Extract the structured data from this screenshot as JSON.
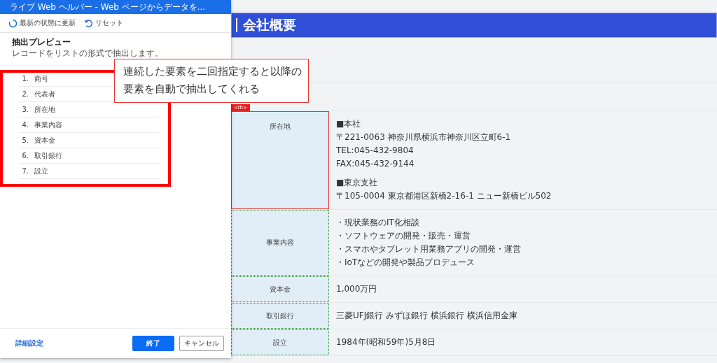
{
  "page": {
    "heading": "会社概要",
    "rows": [
      {
        "label": "所在地",
        "highlighted": true,
        "tag": "<th>",
        "lines": [
          "■本社",
          "〒221-0063 神奈川県横浜市神奈川区立町6-1",
          "TEL:045-432-9804",
          "FAX:045-432-9144",
          "■東京支社",
          "〒105-0004 東京都港区新橋2-16-1 ニュー新橋ビル502"
        ]
      },
      {
        "label": "事業内容",
        "highlighted": false,
        "lines": [
          "・現状業務のIT化相談",
          "・ソフトウェアの開発・販売・運営",
          "・スマホやタブレット用業務アプリの開発・運営",
          "・IoTなどの開発や製品プロデュース"
        ]
      },
      {
        "label": "資本金",
        "highlighted": false,
        "lines": [
          "1,000万円"
        ]
      },
      {
        "label": "取引銀行",
        "highlighted": false,
        "lines": [
          "三菱UFJ銀行 みずほ銀行 横浜銀行 横浜信用金庫"
        ]
      },
      {
        "label": "設立",
        "highlighted": false,
        "lines": [
          "1984年(昭和59年)5月8日"
        ]
      }
    ]
  },
  "window": {
    "title": "ライブ Web ヘルパー - Web ページからデータを...",
    "toolbar": [
      "最新の状態に更新",
      "リセット"
    ],
    "preview_title": "抽出プレビュー",
    "preview_subtitle": "レコードをリストの形式で抽出します。",
    "items": [
      {
        "number": "1.",
        "label": "商号"
      },
      {
        "number": "2.",
        "label": "代表者"
      },
      {
        "number": "3.",
        "label": "所在地"
      },
      {
        "number": "4.",
        "label": "事業内容"
      },
      {
        "number": "5.",
        "label": "資本金"
      },
      {
        "number": "6.",
        "label": "取引銀行"
      },
      {
        "number": "7.",
        "label": "設立"
      }
    ],
    "footer": {
      "link": "詳細設定",
      "primary": "終了",
      "secondary": "キャンセル"
    }
  },
  "callout": [
    "連続した要素を二回指定すると以降の",
    "要素を自動で抽出してくれる"
  ]
}
